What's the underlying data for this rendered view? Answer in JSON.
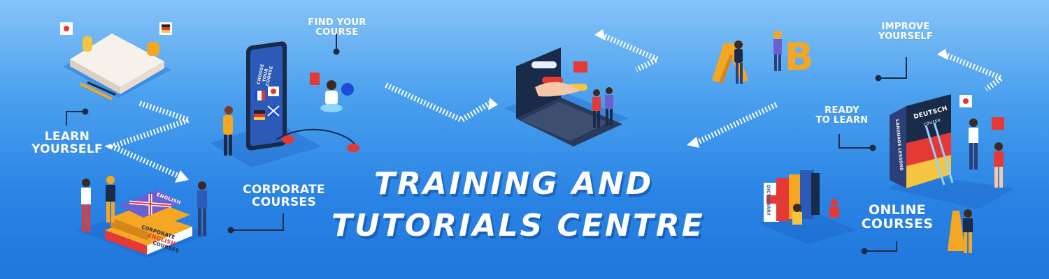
{
  "banner": {
    "headline_line1": "TRAINING AND",
    "headline_line2": "TUTORIALS CENTRE",
    "labels": {
      "learn": "LEARN\nYOURSELF",
      "find": "FIND YOUR\nCOURSE",
      "corporate": "CORPORATE\nCOURSES",
      "improve": "IMPROVE\nYOURSELF",
      "ready": "READY\nTO LEARN",
      "online": "ONLINE\nCOURSES"
    },
    "illustration_text": {
      "phone_caption": "CHOOSE\nYOUR COURSE",
      "book_deutsch": "DEUTSCH",
      "book_course": "course",
      "book_spine": "LANGUAGE LESSONS",
      "corp_book_1": "CORPORATE",
      "corp_book_2": "ENGLISH",
      "corp_book_3": "COURSES",
      "english_book": "ENGLISH",
      "dictionary": "DICTIONARY",
      "letter_a": "A",
      "letter_b": "B"
    },
    "colors": {
      "background_top": "#86c3f7",
      "background_bottom": "#1f76db",
      "text": "#ffffff",
      "accent_orange": "#f5a623",
      "accent_red": "#e53935"
    }
  }
}
